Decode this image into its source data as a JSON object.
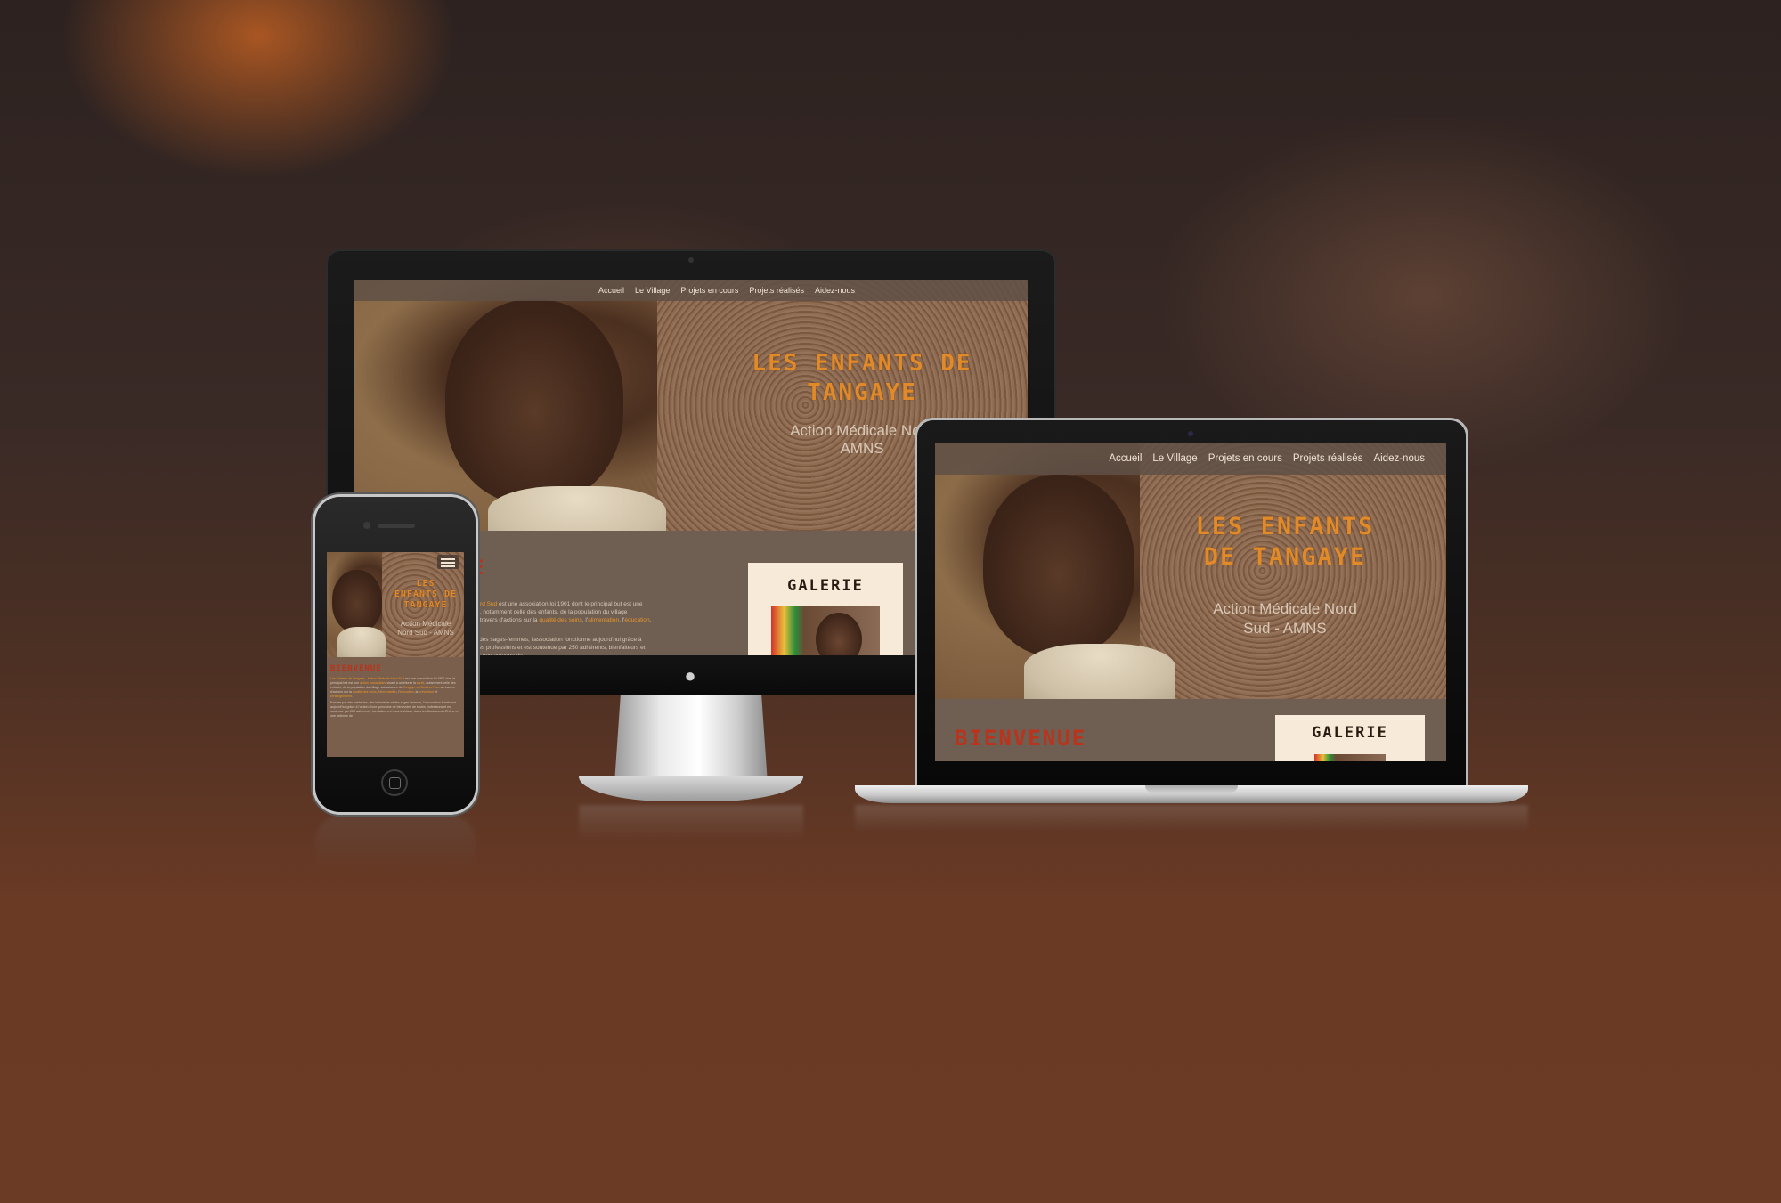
{
  "site": {
    "nav": [
      "Accueil",
      "Le Village",
      "Projets en cours",
      "Projets réalisés",
      "Aidez-nous"
    ],
    "title_line1": "LES ENFANTS DE",
    "title_line2": "TANGAYE",
    "title_mobile": [
      "LES",
      "ENFANTS DE",
      "TANGAYE"
    ],
    "title_laptop": [
      "LES ENFANTS",
      "DE TANGAYE"
    ],
    "subtitle_line1": "Action Médicale Nord",
    "subtitle_line2": "AMNS",
    "subtitle_laptop_line1": "Action Médicale Nord",
    "subtitle_laptop_line2": "Sud - AMNS",
    "subtitle_mobile": [
      "Action Médicale",
      "Nord Sud - AMNS"
    ],
    "welcome": "BIENVENUE",
    "galerie": "GALERIE",
    "paragraph1": [
      {
        "t": "Les Enfants de Tangaye - Action Médicale Nord Sud",
        "hl": true
      },
      {
        "t": " est une association loi 1901 dont le principal but est une ",
        "hl": false
      },
      {
        "t": "action humanitaire",
        "hl": true
      },
      {
        "t": " visant à améliorer la ",
        "hl": false
      },
      {
        "t": "santé",
        "hl": true
      },
      {
        "t": ", notamment celle des enfants, de la population du village subsaharien de ",
        "hl": false
      },
      {
        "t": "Tangaye au Burkina Faso",
        "hl": true
      },
      {
        "t": " au travers d'actions sur la ",
        "hl": false
      },
      {
        "t": "qualité des soins",
        "hl": true
      },
      {
        "t": ", l'",
        "hl": false
      },
      {
        "t": "alimentation",
        "hl": true
      },
      {
        "t": ", l'",
        "hl": false
      },
      {
        "t": "éducation",
        "hl": true
      },
      {
        "t": ", la ",
        "hl": false
      },
      {
        "t": "prévention",
        "hl": true
      },
      {
        "t": " et l'",
        "hl": false
      },
      {
        "t": "enseignement",
        "hl": true
      },
      {
        "t": ".",
        "hl": false
      }
    ],
    "paragraph2": "Fondée par des médecins, des infirmières et des sages-femmes, l'association fonctionne aujourd'hui grâce à l'action d'une quinzaine de bénévoles de toutes professions et est soutenue par 250 adhérents, bienfaiteurs et tous à Velaux, dans les Bouches-du-Rhône et une antenne de"
  },
  "devices": {
    "desktop": "iMac",
    "laptop": "MacBook Pro",
    "phone": "iPhone",
    "apple_logo_icon": "apple-icon",
    "menu_icon": "hamburger-menu-icon"
  },
  "colors": {
    "accent_orange": "#e08a2a",
    "welcome_red": "#b9331d",
    "nav_bg": "#5f5046",
    "content_bg": "#6f5e52",
    "galerie_bg": "#f7ead8"
  }
}
